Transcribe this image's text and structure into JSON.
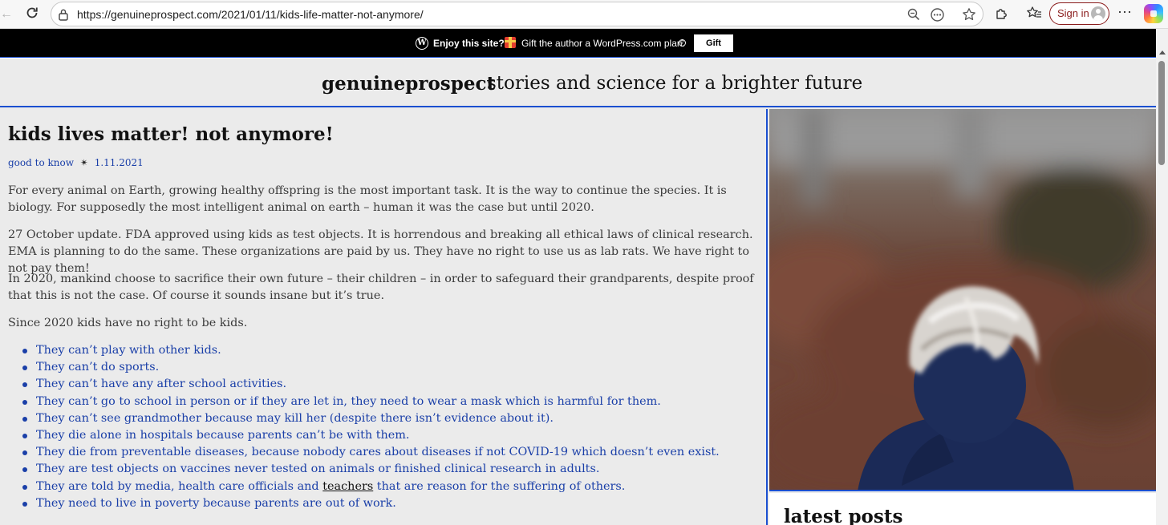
{
  "browser": {
    "url": "https://genuineprospect.com/2021/01/11/kids-life-matter-not-anymore/",
    "sign_in_label": "Sign in"
  },
  "gift_bar": {
    "enjoy_text": "Enjoy this site?",
    "gift_text": "Gift the author a WordPress.com plan.",
    "button_label": "Gift"
  },
  "site": {
    "title": "genuineprospect",
    "tagline": "stories and science for a brighter future"
  },
  "post": {
    "title": "kids lives matter! not anymore!",
    "category": "good to know",
    "separator": "✴",
    "date": "1.11.2021",
    "paragraphs": [
      "For every animal on Earth, growing healthy offspring is the most important task. It is the way to continue the species. It is biology. For supposedly the most intelligent animal on earth – human it was the case but until 2020.",
      "27 October update. FDA approved using kids as test objects. It is horrendous and breaking all ethical laws of clinical research. EMA is planning to do the same. These organizations are paid by us. They have no right to use us as lab rats. We have right to not pay them!",
      "In 2020, mankind choose to sacrifice their own future – their children – in order to safeguard their grandparents, despite proof that this is not the case. Of course it sounds insane but it’s true.",
      "Since 2020 kids have no right to be kids."
    ],
    "list": [
      "They can’t play with other kids.",
      "They can’t do sports.",
      "They can’t have any after school activities.",
      "They can’t go to school in person or if they are let in, they need to wear a mask which is harmful for them.",
      "They can’t see grandmother because may kill her (despite there isn’t evidence about it).",
      "They die alone in hospitals because parents can’t be with them.",
      "They die from preventable diseases, because nobody cares about diseases if not COVID-19 which doesn’t even exist.",
      "They are test objects on vaccines never tested on animals or finished clinical research in adults."
    ],
    "list_item_9": {
      "before": "They are told by media, health care officials and ",
      "link": "teachers",
      "after": " that are reason for the suffering of others."
    },
    "list_item_10": "They need to live in poverty because parents are out of work."
  },
  "sidebar": {
    "latest_heading": "latest posts"
  },
  "colors": {
    "accent_blue": "#1a4fd0",
    "link_blue": "#1a3fa8",
    "page_bg": "#ebebeb",
    "signin_red": "#8a1c1c"
  }
}
